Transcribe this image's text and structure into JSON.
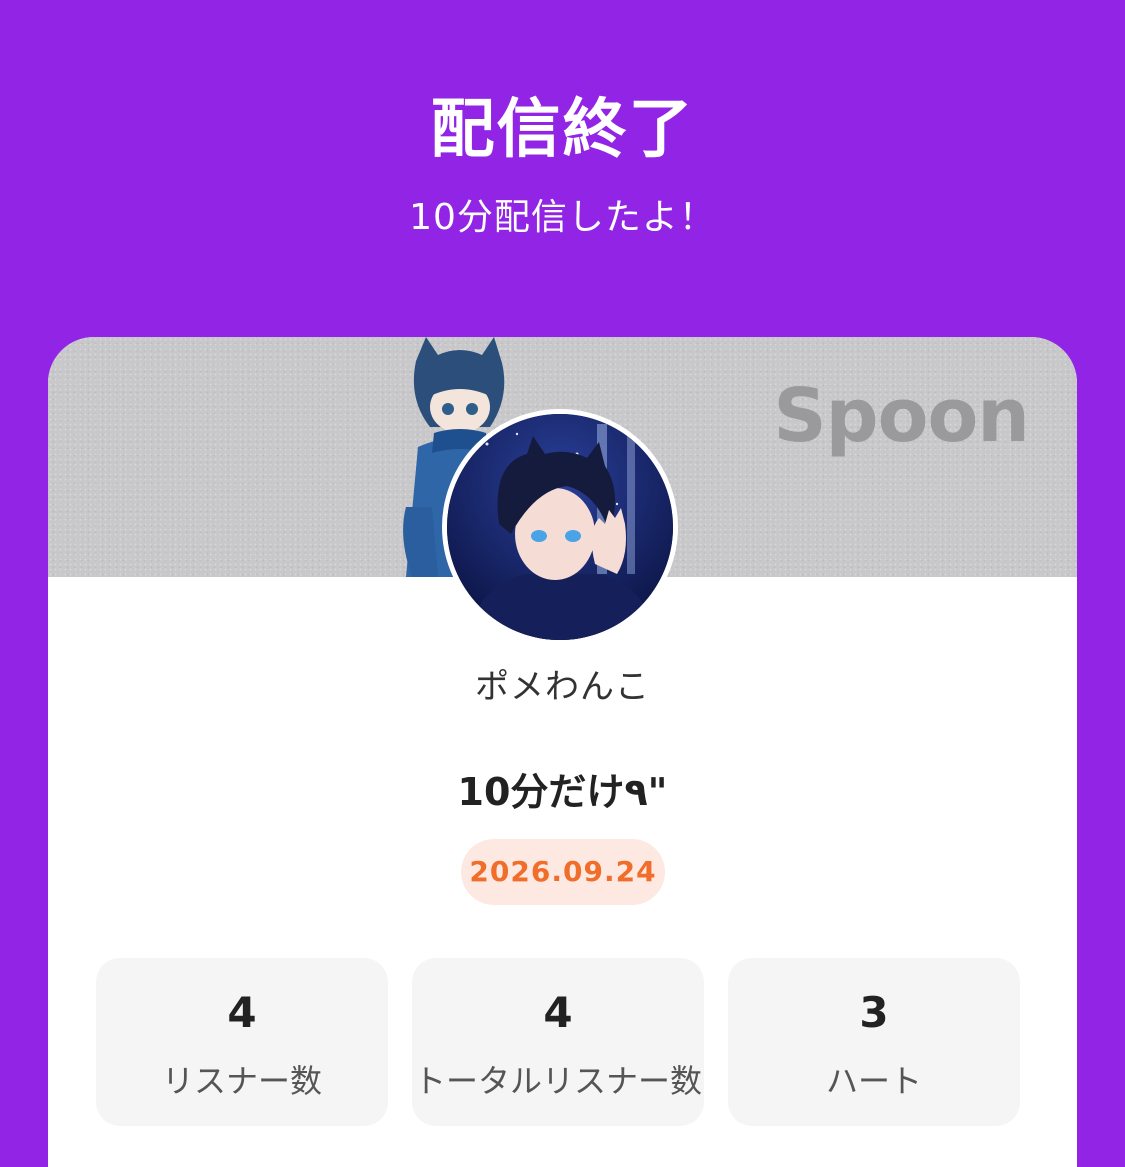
{
  "header": {
    "title": "配信終了",
    "subtitle": "10分配信したよ！"
  },
  "card": {
    "brand": "Spoon",
    "username": "ポメわんこ",
    "live_title": "10分だけ٩\"",
    "date": "2026.09.24",
    "stats": [
      {
        "value": "4",
        "label": "リスナー数"
      },
      {
        "value": "4",
        "label": "トータルリスナー数"
      },
      {
        "value": "3",
        "label": "ハート"
      }
    ]
  },
  "colors": {
    "background": "#9224e6",
    "card": "#ffffff",
    "banner": "#c8c7ca",
    "date_text": "#f06d2a",
    "date_bg": "#fde9e2",
    "stat_bg": "#f5f5f5"
  }
}
